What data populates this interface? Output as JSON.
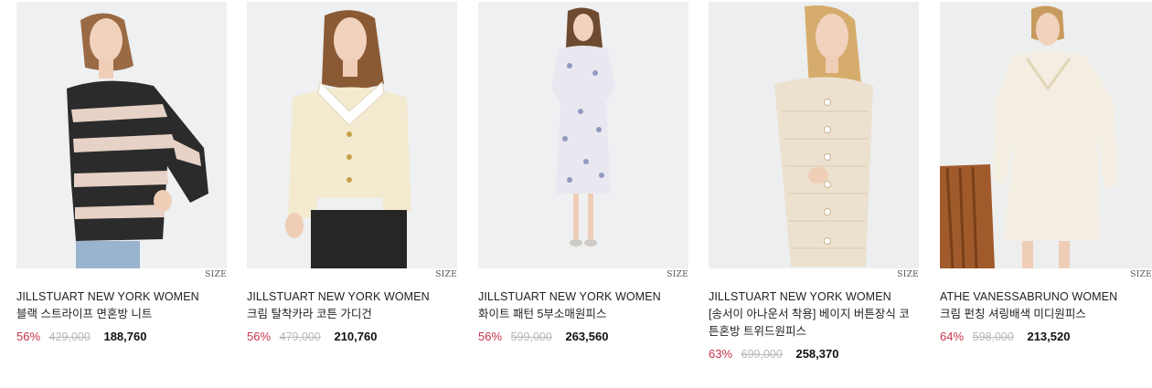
{
  "products": [
    {
      "brand": "JILLSTUART NEW YORK WOMEN",
      "name": "블랙 스트라이프 면혼방 니트",
      "discount": "56%",
      "original_price": "429,000",
      "price": "188,760",
      "size_label": "SIZE",
      "bg_color": "#eef0f1",
      "garment_color": "#2b2b2b"
    },
    {
      "brand": "JILLSTUART NEW YORK WOMEN",
      "name": "크림 탈착카라 코튼 가디건",
      "discount": "56%",
      "original_price": "479,000",
      "price": "210,760",
      "size_label": "SIZE",
      "bg_color": "#eef0f1",
      "garment_color": "#f3ead0"
    },
    {
      "brand": "JILLSTUART NEW YORK WOMEN",
      "name": "화이트 패턴 5부소매원피스",
      "discount": "56%",
      "original_price": "599,000",
      "price": "263,560",
      "size_label": "SIZE",
      "bg_color": "#eef0f1",
      "garment_color": "#e9e8f0"
    },
    {
      "brand": "JILLSTUART NEW YORK WOMEN",
      "name": "[송서이 아나운서 착용] 베이지 버튼장식 코튼혼방 트위드원피스",
      "discount": "63%",
      "original_price": "699,000",
      "price": "258,370",
      "size_label": "SIZE",
      "bg_color": "#eceeef",
      "garment_color": "#ece1cf"
    },
    {
      "brand": "ATHE VANESSABRUNO WOMEN",
      "name": "크림 펀칭 셔링배색 미디원피스",
      "discount": "64%",
      "original_price": "598,000",
      "price": "213,520",
      "size_label": "SIZE",
      "bg_color": "#edeeee",
      "garment_color": "#f3eee1"
    }
  ]
}
